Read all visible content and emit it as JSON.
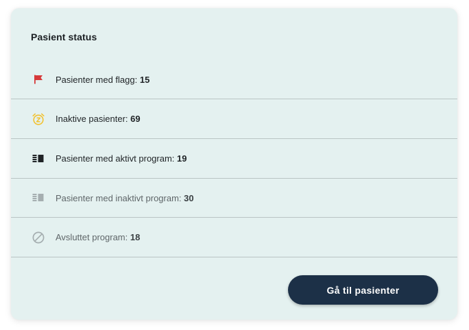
{
  "card": {
    "title": "Pasient status"
  },
  "rows": [
    {
      "icon": "flag-icon",
      "label": "Pasienter med flagg: ",
      "count": "15",
      "muted": false
    },
    {
      "icon": "snooze-alarm-icon",
      "label": "Inaktive pasienter: ",
      "count": "69",
      "muted": false
    },
    {
      "icon": "active-program-icon",
      "label": "Pasienter med aktivt program: ",
      "count": "19",
      "muted": false
    },
    {
      "icon": "inactive-program-icon",
      "label": "Pasienter med inaktivt program: ",
      "count": "30",
      "muted": true
    },
    {
      "icon": "block-icon",
      "label": "Avsluttet program: ",
      "count": "18",
      "muted": true
    }
  ],
  "actions": {
    "goto_patients_label": "Gå til pasienter"
  },
  "colors": {
    "card_bg": "#e4f1f0",
    "button_bg": "#1c3047",
    "flag": "#d63a3a",
    "alarm": "#f2c230",
    "divider": "#b9c4c4"
  }
}
